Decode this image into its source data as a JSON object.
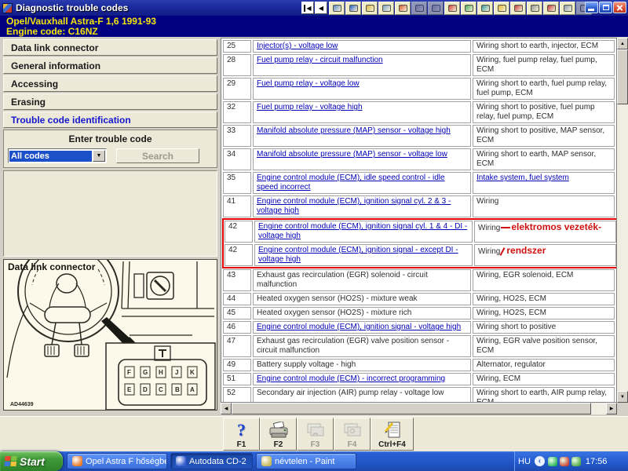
{
  "window": {
    "title": "Diagnostic trouble codes"
  },
  "titlebar": {
    "icons": [
      {
        "name": "technical-data-icon",
        "color": "#5a86c8",
        "disabled": false
      },
      {
        "name": "gauge-icon",
        "color": "#2d62c8",
        "disabled": false
      },
      {
        "name": "engine-oil-icon",
        "color": "#d8b440",
        "disabled": false
      },
      {
        "name": "inspection-icon",
        "color": "#7aa0c8",
        "disabled": false
      },
      {
        "name": "spanner-icon",
        "color": "#d85c30",
        "disabled": false
      },
      {
        "name": "car-gray-icon",
        "color": "#b0ac9e",
        "disabled": true
      },
      {
        "name": "brush-icon",
        "color": "#a8a498",
        "disabled": true
      },
      {
        "name": "service-schedule-icon",
        "color": "#d04038",
        "disabled": false
      },
      {
        "name": "tyre-icon",
        "color": "#48a860",
        "disabled": false
      },
      {
        "name": "car-repair-icon",
        "color": "#3898a0",
        "disabled": false
      },
      {
        "name": "help-car-icon",
        "color": "#e0b830",
        "disabled": false
      },
      {
        "name": "wiring-diagram-icon",
        "color": "#c04040",
        "disabled": false
      },
      {
        "name": "wheel-icon",
        "color": "#8e968e",
        "disabled": false
      },
      {
        "name": "warning-triangle-icon",
        "color": "#c83838",
        "disabled": false
      },
      {
        "name": "car-side-icon",
        "color": "#8898b0",
        "disabled": false
      },
      {
        "name": "document-icon",
        "color": "#c8c4a0",
        "disabled": true
      }
    ]
  },
  "header": {
    "vehicle": "Opel/Vauxhall    Astra-F 1,6    1991-93",
    "engine": "Engine code: C16NZ"
  },
  "sidebar": {
    "items": [
      {
        "label": "Data link connector",
        "active": false
      },
      {
        "label": "General information",
        "active": false
      },
      {
        "label": "Accessing",
        "active": false
      },
      {
        "label": "Erasing",
        "active": false
      },
      {
        "label": "Trouble code identification",
        "active": true
      }
    ],
    "enter_code_label": "Enter trouble code",
    "code_select_value": "All codes",
    "search_label": "Search"
  },
  "diagram": {
    "title": "Data link connector",
    "figure_id": "AD44639",
    "pins_top": [
      "F",
      "G",
      "H",
      "J",
      "K"
    ],
    "pins_bottom": [
      "E",
      "D",
      "C",
      "B",
      "A"
    ]
  },
  "table": {
    "rows": [
      {
        "code": "25",
        "description": "Injector(s) - voltage low",
        "desc_link": true,
        "info": "Wiring short to earth, injector, ECM",
        "info_link": false,
        "red_box": false
      },
      {
        "code": "28",
        "description": "Fuel pump relay - circuit malfunction",
        "desc_link": true,
        "info": "Wiring, fuel pump relay, fuel pump, ECM",
        "info_link": false,
        "red_box": false
      },
      {
        "code": "29",
        "description": "Fuel pump relay - voltage low",
        "desc_link": true,
        "info": "Wiring short to earth, fuel pump relay, fuel pump, ECM",
        "info_link": false,
        "red_box": false
      },
      {
        "code": "32",
        "description": "Fuel pump relay - voltage high",
        "desc_link": true,
        "info": "Wiring short to positive, fuel pump relay, fuel pump, ECM",
        "info_link": false,
        "red_box": false
      },
      {
        "code": "33",
        "description": "Manifold absolute pressure (MAP) sensor - voltage high",
        "desc_link": true,
        "info": "Wiring short to positive, MAP sensor, ECM",
        "info_link": false,
        "red_box": false
      },
      {
        "code": "34",
        "description": "Manifold absolute pressure (MAP) sensor - voltage low",
        "desc_link": true,
        "info": "Wiring short to earth, MAP sensor, ECM",
        "info_link": false,
        "red_box": false
      },
      {
        "code": "35",
        "description": "Engine control module (ECM), idle speed control - idle speed incorrect",
        "desc_link": true,
        "info": "Intake system, fuel system",
        "info_link": true,
        "red_box": false
      },
      {
        "code": "41",
        "description": "Engine control module (ECM), ignition signal cyl. 2 & 3 - voltage high",
        "desc_link": true,
        "info": "Wiring",
        "info_link": false,
        "red_box": false
      },
      {
        "code": "42",
        "description": "Engine control module (ECM), ignition signal cyl. 1 & 4 - DI - voltage high",
        "desc_link": true,
        "info": "Wiring",
        "info_link": false,
        "red_box": true,
        "annotation": "elektromos vezeték-",
        "annotation_mark": "dash"
      },
      {
        "code": "42",
        "description": "Engine control module (ECM), ignition signal - except DI - voltage high",
        "desc_link": true,
        "info": "Wiring",
        "info_link": false,
        "red_box": true,
        "annotation": "rendszer",
        "annotation_mark": "slash"
      },
      {
        "code": "43",
        "description": "Exhaust gas recirculation (EGR) solenoid - circuit malfunction",
        "desc_link": false,
        "info": "Wiring, EGR solenoid, ECM",
        "info_link": false,
        "red_box": false
      },
      {
        "code": "44",
        "description": "Heated oxygen sensor (HO2S) - mixture weak",
        "desc_link": false,
        "info": "Wiring, HO2S, ECM",
        "info_link": false,
        "red_box": false
      },
      {
        "code": "45",
        "description": "Heated oxygen sensor (HO2S) - mixture rich",
        "desc_link": false,
        "info": "Wiring, HO2S, ECM",
        "info_link": false,
        "red_box": false
      },
      {
        "code": "46",
        "description": "Engine control module (ECM), ignition signal - voltage high",
        "desc_link": true,
        "info": "Wiring short to positive",
        "info_link": false,
        "red_box": false
      },
      {
        "code": "47",
        "description": "Exhaust gas recirculation (EGR) valve position sensor - circuit malfunction",
        "desc_link": false,
        "info": "Wiring, EGR valve position sensor, ECM",
        "info_link": false,
        "red_box": false
      },
      {
        "code": "49",
        "description": "Battery supply voltage - high",
        "desc_link": false,
        "info": "Alternator, regulator",
        "info_link": false,
        "red_box": false
      },
      {
        "code": "51",
        "description": "Engine control module (ECM) - incorrect programming",
        "desc_link": true,
        "info": "Wiring, ECM",
        "info_link": false,
        "red_box": false
      },
      {
        "code": "52",
        "description": "Secondary air injection (AIR) pump relay - voltage low",
        "desc_link": false,
        "info": "Wiring short to earth, AIR pump relay, ECM",
        "info_link": false,
        "red_box": false
      }
    ]
  },
  "annotation": {
    "color": "#d01010",
    "line1": "elektromos vezeték-",
    "line2": "rendszer"
  },
  "function_bar": {
    "buttons": [
      {
        "key": "F1",
        "icon": "help-icon",
        "enabled": true
      },
      {
        "key": "F2",
        "icon": "print-icon",
        "enabled": true
      },
      {
        "key": "F3",
        "icon": "picture-icon",
        "enabled": false
      },
      {
        "key": "F4",
        "icon": "pictures-icon",
        "enabled": false
      },
      {
        "key": "Ctrl+F4",
        "icon": "notes-icon",
        "enabled": true
      }
    ]
  },
  "taskbar": {
    "start_label": "Start",
    "windows": [
      {
        "title": "Opel Astra F hőségbe...",
        "icon": "firefox-icon",
        "icon_color": "#e87d2a",
        "active": false
      },
      {
        "title": "Autodata CD-2",
        "icon": "autodata-icon",
        "icon_color": "#3a5fd0",
        "active": true
      },
      {
        "title": "névtelen - Paint",
        "icon": "paint-icon",
        "icon_color": "#c8b85a",
        "active": false
      }
    ],
    "tray": {
      "language": "HU",
      "icons": [
        {
          "name": "utorrent-icon",
          "color": "#2bb65a"
        },
        {
          "name": "antivirus-icon",
          "color": "#cc4433"
        },
        {
          "name": "shield-icon",
          "color": "#55aa44"
        }
      ],
      "time": "17:56"
    }
  }
}
